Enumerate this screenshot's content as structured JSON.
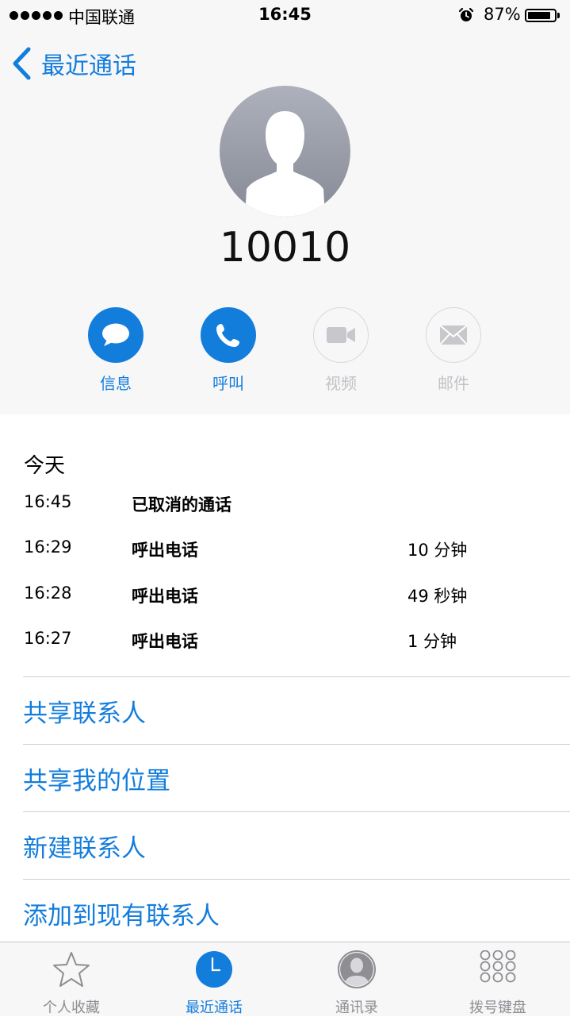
{
  "status_bar": {
    "carrier": "中国联通",
    "time": "16:45",
    "battery_percent": "87%",
    "battery_level": 0.87
  },
  "nav": {
    "back_label": "最近通话"
  },
  "contact": {
    "number": "10010"
  },
  "actions": [
    {
      "label": "信息",
      "icon": "message-bubble-icon",
      "enabled": true
    },
    {
      "label": "呼叫",
      "icon": "phone-icon",
      "enabled": true
    },
    {
      "label": "视频",
      "icon": "video-camera-icon",
      "enabled": false
    },
    {
      "label": "邮件",
      "icon": "mail-envelope-icon",
      "enabled": false
    }
  ],
  "calls": {
    "section_title": "今天",
    "entries": [
      {
        "time": "16:45",
        "type": "已取消的通话",
        "duration": ""
      },
      {
        "time": "16:29",
        "type": "呼出电话",
        "duration": "10 分钟"
      },
      {
        "time": "16:28",
        "type": "呼出电话",
        "duration": "49 秒钟"
      },
      {
        "time": "16:27",
        "type": "呼出电话",
        "duration": "1 分钟"
      }
    ]
  },
  "options": [
    {
      "label": "共享联系人"
    },
    {
      "label": "共享我的位置"
    },
    {
      "label": "新建联系人"
    },
    {
      "label": "添加到现有联系人"
    }
  ],
  "tabs": [
    {
      "label": "个人收藏",
      "icon": "star-icon",
      "active": false
    },
    {
      "label": "最近通话",
      "icon": "clock-icon",
      "active": true
    },
    {
      "label": "通讯录",
      "icon": "contacts-person-icon",
      "active": false
    },
    {
      "label": "拨号键盘",
      "icon": "keypad-icon",
      "active": false
    }
  ],
  "colors": {
    "accent": "#137ddc",
    "disabled": "#c2c2c7",
    "inactive_tab": "#8e8e93"
  }
}
